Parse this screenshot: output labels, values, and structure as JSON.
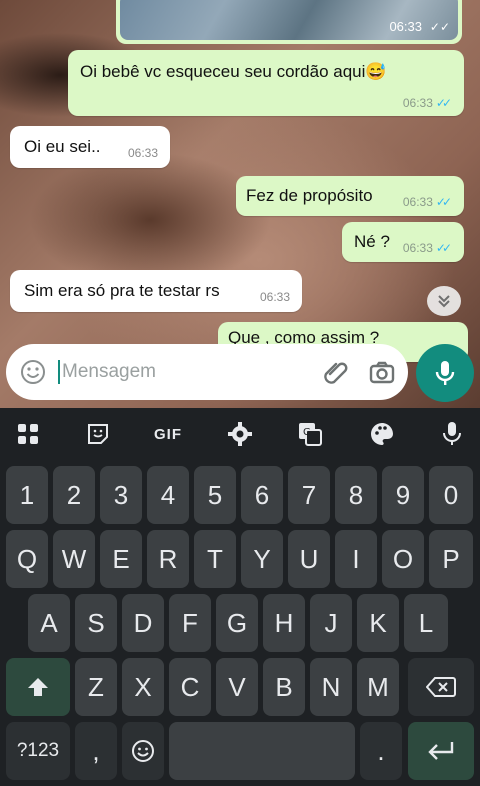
{
  "messages": [
    {
      "type": "image",
      "direction": "out",
      "time": "06:33"
    },
    {
      "direction": "out",
      "text": "Oi bebê vc esqueceu seu cordão aqui😅",
      "time": "06:33",
      "read": true
    },
    {
      "direction": "in",
      "text": "Oi eu sei..",
      "time": "06:33"
    },
    {
      "direction": "out",
      "text": "Fez de propósito",
      "time": "06:33",
      "read": true
    },
    {
      "direction": "out",
      "text": "Né ?",
      "time": "06:33",
      "read": true
    },
    {
      "direction": "in",
      "text": "Sim era só pra te testar rs",
      "time": "06:33"
    },
    {
      "direction": "out",
      "text": "Que , como assim ?",
      "time": "",
      "partial": true
    }
  ],
  "composer": {
    "placeholder": "Mensagem"
  },
  "keyboard": {
    "toolbar": [
      "apps-icon",
      "sticker-icon",
      "GIF",
      "settings-icon",
      "translate-icon",
      "palette-icon",
      "mic-icon"
    ],
    "gif_label": "GIF",
    "row1": [
      "1",
      "2",
      "3",
      "4",
      "5",
      "6",
      "7",
      "8",
      "9",
      "0"
    ],
    "row2": [
      "Q",
      "W",
      "E",
      "R",
      "T",
      "Y",
      "U",
      "I",
      "O",
      "P"
    ],
    "row3": [
      "A",
      "S",
      "D",
      "F",
      "G",
      "H",
      "J",
      "K",
      "L"
    ],
    "row4": [
      "Z",
      "X",
      "C",
      "V",
      "B",
      "N",
      "M"
    ],
    "symbols_label": "?123",
    "comma": ",",
    "period": "."
  },
  "colors": {
    "outgoing": "#dcf8c6",
    "incoming": "#ffffff",
    "accent": "#128c7e",
    "read_tick": "#34b7f1"
  }
}
